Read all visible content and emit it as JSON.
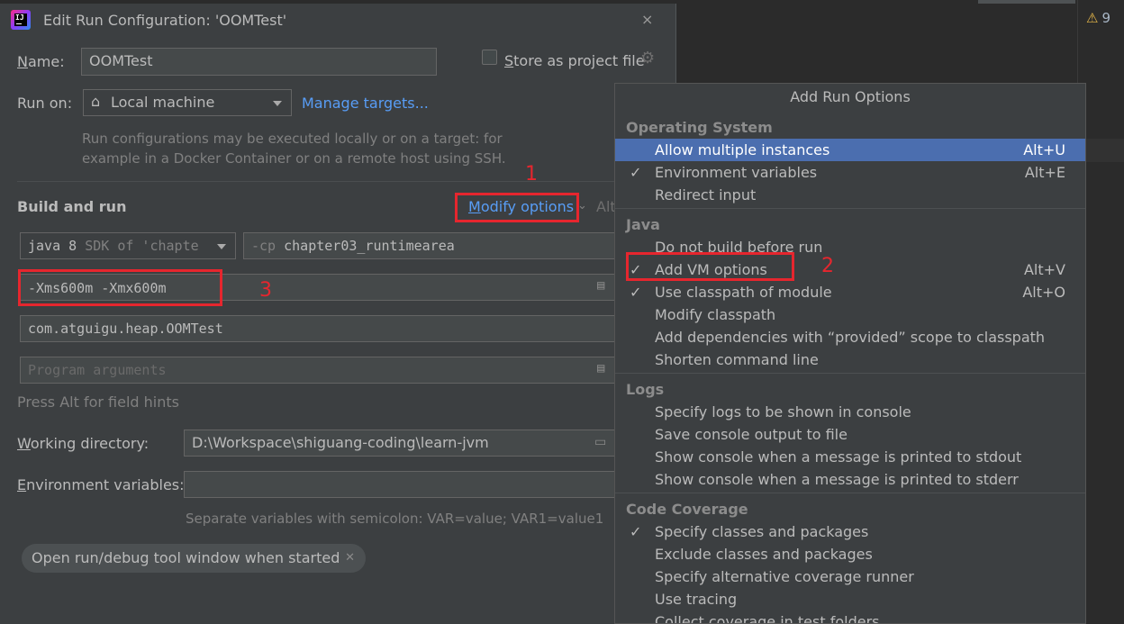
{
  "window": {
    "title": "Edit Run Configuration: 'OOMTest'",
    "close_icon": "×"
  },
  "name": {
    "label_u": "N",
    "label_rest": "ame:",
    "value": "OOMTest"
  },
  "store": {
    "label_u": "S",
    "label_rest": "tore as project file"
  },
  "run_on": {
    "label": "Run on:",
    "value": "Local machine",
    "manage_link": "Manage targets...",
    "hint_line1": "Run configurations may be executed locally or on a target: for",
    "hint_line2": "example in a Docker Container or on a remote host using SSH."
  },
  "build": {
    "section_title": "Build and run",
    "modify_u": "M",
    "modify_rest": "odify options",
    "modify_shortcut": "Alt",
    "sdk_value": "java 8",
    "sdk_hint": "SDK of 'chapte",
    "cp_prefix": "-cp",
    "cp_value": "chapter03_runtimearea",
    "vm_options": "-Xms600m -Xmx600m",
    "main_class": "com.atguigu.heap.OOMTest",
    "program_args_placeholder": "Program arguments",
    "field_hint": "Press Alt for field hints"
  },
  "workdir": {
    "label_u": "W",
    "label_rest": "orking directory:",
    "value": "D:\\Workspace\\shiguang-coding\\learn-jvm"
  },
  "envvars": {
    "label_u": "E",
    "label_rest": "nvironment variables:",
    "value": "",
    "hint": "Separate variables with semicolon: VAR=value; VAR1=value1"
  },
  "chip": {
    "label": "Open run/debug tool window when started"
  },
  "annotations": {
    "n1": "1",
    "n2": "2",
    "n3": "3"
  },
  "editor": {
    "warning_count": "9"
  },
  "menu": {
    "title": "Add Run Options",
    "groups": [
      {
        "name": "Operating System",
        "items": [
          {
            "label": "Allow multiple instances",
            "shortcut": "Alt+U",
            "checked": false,
            "selected": true
          },
          {
            "label": "Environment variables",
            "shortcut": "Alt+E",
            "checked": true
          },
          {
            "label": "Redirect input",
            "shortcut": "",
            "checked": false
          }
        ]
      },
      {
        "name": "Java",
        "items": [
          {
            "label": "Do not build before run",
            "shortcut": "",
            "checked": false
          },
          {
            "label": "Add VM options",
            "shortcut": "Alt+V",
            "checked": true
          },
          {
            "label": "Use classpath of module",
            "shortcut": "Alt+O",
            "checked": true
          },
          {
            "label": "Modify classpath",
            "shortcut": "",
            "checked": false
          },
          {
            "label": "Add dependencies with “provided” scope to classpath",
            "shortcut": "",
            "checked": false
          },
          {
            "label": "Shorten command line",
            "shortcut": "",
            "checked": false
          }
        ]
      },
      {
        "name": "Logs",
        "items": [
          {
            "label": "Specify logs to be shown in console",
            "shortcut": "",
            "checked": false
          },
          {
            "label": "Save console output to file",
            "shortcut": "",
            "checked": false
          },
          {
            "label": "Show console when a message is printed to stdout",
            "shortcut": "",
            "checked": false
          },
          {
            "label": "Show console when a message is printed to stderr",
            "shortcut": "",
            "checked": false
          }
        ]
      },
      {
        "name": "Code Coverage",
        "items": [
          {
            "label": "Specify classes and packages",
            "shortcut": "",
            "checked": true
          },
          {
            "label": "Exclude classes and packages",
            "shortcut": "",
            "checked": false
          },
          {
            "label": "Specify alternative coverage runner",
            "shortcut": "",
            "checked": false
          },
          {
            "label": "Use tracing",
            "shortcut": "",
            "checked": false
          },
          {
            "label": "Collect coverage in test folders",
            "shortcut": "",
            "checked": false
          }
        ]
      }
    ]
  },
  "colors": {
    "accent": "#589df6",
    "selection": "#4b6eaf",
    "annotation": "#e6262e",
    "dialog_bg": "#3c3f41"
  }
}
